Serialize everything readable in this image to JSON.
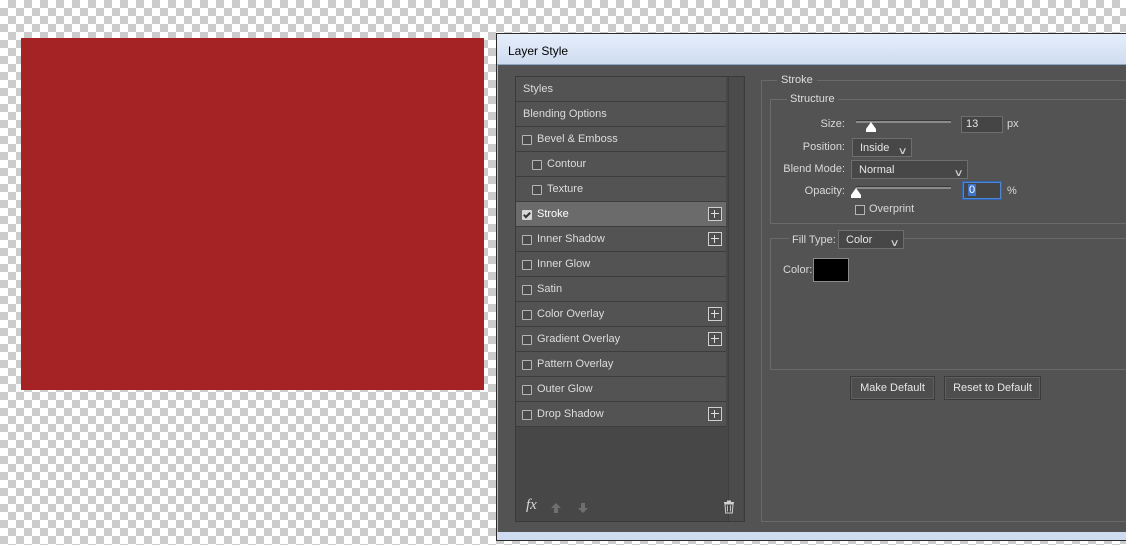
{
  "canvas": {
    "fill_color": "#a52324"
  },
  "dialog": {
    "title": "Layer Style"
  },
  "styles_list": {
    "items": [
      {
        "label": "Styles",
        "type": "plain",
        "checked": false,
        "has_plus": false
      },
      {
        "label": "Blending Options",
        "type": "plain",
        "checked": false,
        "has_plus": false
      },
      {
        "label": "Bevel & Emboss",
        "type": "checkable",
        "checked": false,
        "has_plus": false
      },
      {
        "label": "Contour",
        "type": "sub",
        "checked": false,
        "has_plus": false
      },
      {
        "label": "Texture",
        "type": "sub",
        "checked": false,
        "has_plus": false
      },
      {
        "label": "Stroke",
        "type": "checkable",
        "checked": true,
        "selected": true,
        "has_plus": true
      },
      {
        "label": "Inner Shadow",
        "type": "checkable",
        "checked": false,
        "has_plus": true
      },
      {
        "label": "Inner Glow",
        "type": "checkable",
        "checked": false,
        "has_plus": false
      },
      {
        "label": "Satin",
        "type": "checkable",
        "checked": false,
        "has_plus": false
      },
      {
        "label": "Color Overlay",
        "type": "checkable",
        "checked": false,
        "has_plus": true
      },
      {
        "label": "Gradient Overlay",
        "type": "checkable",
        "checked": false,
        "has_plus": true
      },
      {
        "label": "Pattern Overlay",
        "type": "checkable",
        "checked": false,
        "has_plus": false
      },
      {
        "label": "Outer Glow",
        "type": "checkable",
        "checked": false,
        "has_plus": false
      },
      {
        "label": "Drop Shadow",
        "type": "checkable",
        "checked": false,
        "has_plus": true
      }
    ],
    "footer": {
      "fx_label": "fx",
      "icons": [
        "move-up-icon",
        "move-down-icon",
        "trash-icon"
      ]
    }
  },
  "stroke": {
    "section_title": "Stroke",
    "structure": {
      "title": "Structure",
      "size_label": "Size:",
      "size_value": "13",
      "size_unit": "px",
      "size_slider_fraction": 0.1,
      "position_label": "Position:",
      "position_value": "Inside",
      "blend_mode_label": "Blend Mode:",
      "blend_mode_value": "Normal",
      "opacity_label": "Opacity:",
      "opacity_value": "0",
      "opacity_unit": "%",
      "opacity_slider_fraction": 0.0,
      "overprint_label": "Overprint",
      "overprint_checked": false
    },
    "fill": {
      "fill_type_label": "Fill Type:",
      "fill_type_value": "Color",
      "color_label": "Color:",
      "color_value": "#000000"
    },
    "buttons": {
      "make_default": "Make Default",
      "reset_default": "Reset to Default"
    }
  }
}
